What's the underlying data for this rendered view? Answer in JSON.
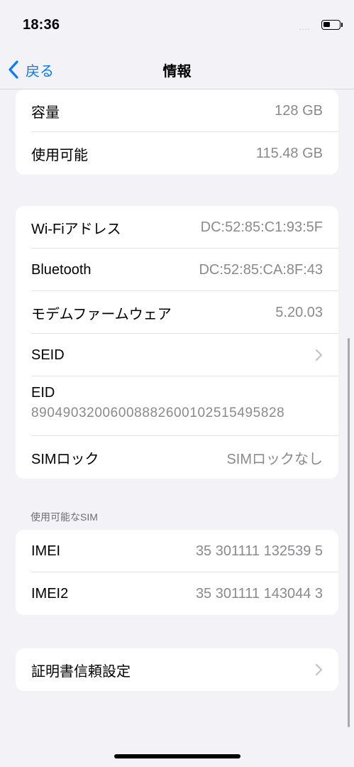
{
  "status_bar": {
    "time": "18:36",
    "signal": "....",
    "battery_level": 0.45
  },
  "nav": {
    "back_label": "戻る",
    "title": "情報"
  },
  "storage": [
    {
      "label": "容量",
      "value": "128 GB"
    },
    {
      "label": "使用可能",
      "value": "115.48 GB"
    }
  ],
  "network": {
    "wifi": {
      "label": "Wi-Fiアドレス",
      "value": "DC:52:85:C1:93:5F"
    },
    "bluetooth": {
      "label": "Bluetooth",
      "value": "DC:52:85:CA:8F:43"
    },
    "modem": {
      "label": "モデムファームウェア",
      "value": "5.20.03"
    },
    "seid": {
      "label": "SEID"
    },
    "eid": {
      "label": "EID",
      "value": "89049032006008882600102515495828"
    },
    "sim_lock": {
      "label": "SIMロック",
      "value": "SIMロックなし"
    }
  },
  "sim_section": {
    "header": "使用可能なSIM",
    "imei": {
      "label": "IMEI",
      "value": "35 301111 132539 5"
    },
    "imei2": {
      "label": "IMEI2",
      "value": "35 301111 143044 3"
    }
  },
  "certificate": {
    "label": "証明書信頼設定"
  },
  "colors": {
    "accent": "#0a7aff",
    "background": "#f2f2f7",
    "secondary_text": "#8a8a8e"
  },
  "icons": {
    "back": "chevron-left-icon",
    "disclosure": "chevron-right-icon",
    "battery": "battery-icon"
  }
}
